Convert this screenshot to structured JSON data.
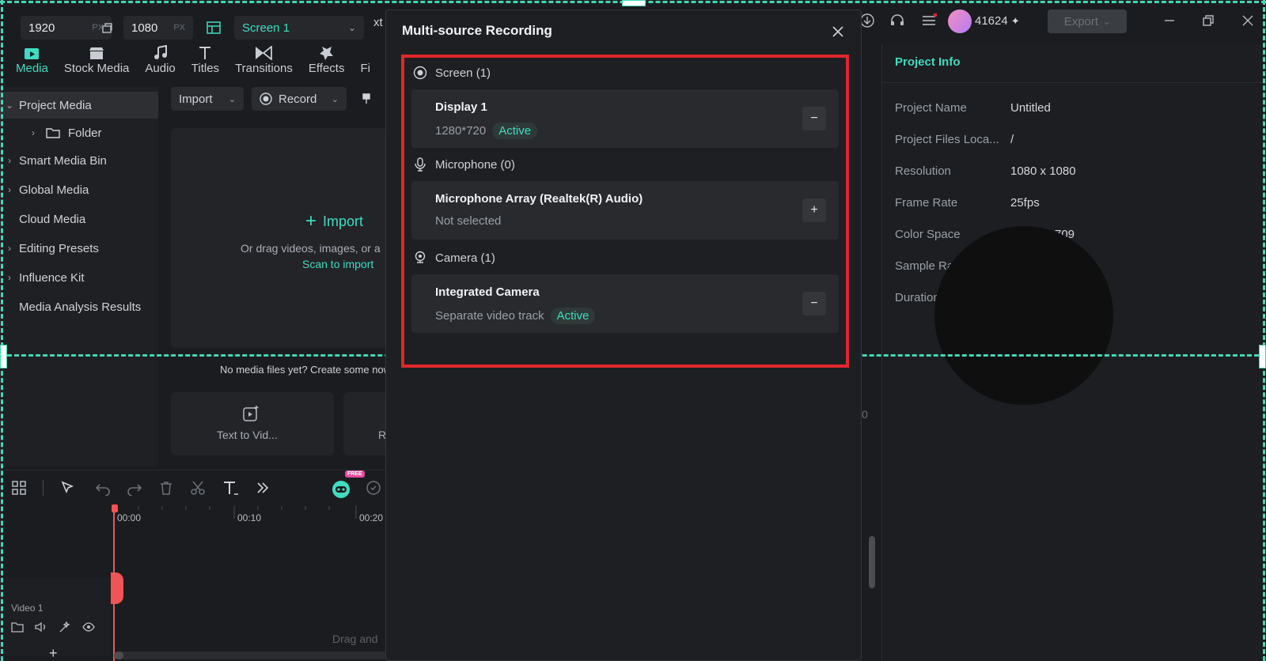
{
  "topbar": {
    "width_value": "1920",
    "height_value": "1080",
    "unit": "PX",
    "screen_select": "Screen 1",
    "partial_label": "xt",
    "credits": "41624",
    "export_label": "Export"
  },
  "tabs": [
    {
      "label": "Media"
    },
    {
      "label": "Stock Media"
    },
    {
      "label": "Audio"
    },
    {
      "label": "Titles"
    },
    {
      "label": "Transitions"
    },
    {
      "label": "Effects"
    },
    {
      "label": "Fi"
    }
  ],
  "sidebar": {
    "items": [
      {
        "label": "Project Media"
      },
      {
        "label": "Folder"
      },
      {
        "label": "Smart Media Bin"
      },
      {
        "label": "Global Media"
      },
      {
        "label": "Cloud Media"
      },
      {
        "label": "Editing Presets"
      },
      {
        "label": "Influence Kit"
      },
      {
        "label": "Media Analysis Results"
      }
    ]
  },
  "media": {
    "import_btn": "Import",
    "record_btn": "Record",
    "drop_import": "Import",
    "drop_hint": "Or drag videos, images, or a",
    "scan_link": "Scan to import",
    "no_media": "No media files yet? Create some now",
    "card1": "Text to Vid...",
    "card2": "R"
  },
  "timeline": {
    "ticks": [
      "00:00",
      "00:10",
      "00:20"
    ],
    "track_label": "Video 1",
    "drag_hint": "Drag and",
    "free_badge": "FREE"
  },
  "project_info": {
    "title": "Project Info",
    "rows": [
      {
        "k": "Project Name",
        "v": "Untitled"
      },
      {
        "k": "Project Files Loca...",
        "v": "/"
      },
      {
        "k": "Resolution",
        "v": "1080 x 1080"
      },
      {
        "k": "Frame Rate",
        "v": "25fps"
      },
      {
        "k": "Color Space",
        "v": "709"
      },
      {
        "k": "Sample Rat",
        "v": ""
      },
      {
        "k": "Duration",
        "v": ""
      }
    ],
    "side_num": "0"
  },
  "modal": {
    "title": "Multi-source Recording",
    "screen_header": "Screen (1)",
    "display_name": "Display 1",
    "display_res": "1280*720",
    "display_status": "Active",
    "mic_header": "Microphone (0)",
    "mic_name": "Microphone Array (Realtek(R) Audio)",
    "mic_status": "Not selected",
    "camera_header": "Camera (1)",
    "camera_name": "Integrated Camera",
    "camera_sub": "Separate video track",
    "camera_status": "Active",
    "minus": "−",
    "plus": "+"
  },
  "colors": {
    "accent": "#3fdcc1",
    "highlight": "#e2262c",
    "dashed": "#41d6b6"
  }
}
